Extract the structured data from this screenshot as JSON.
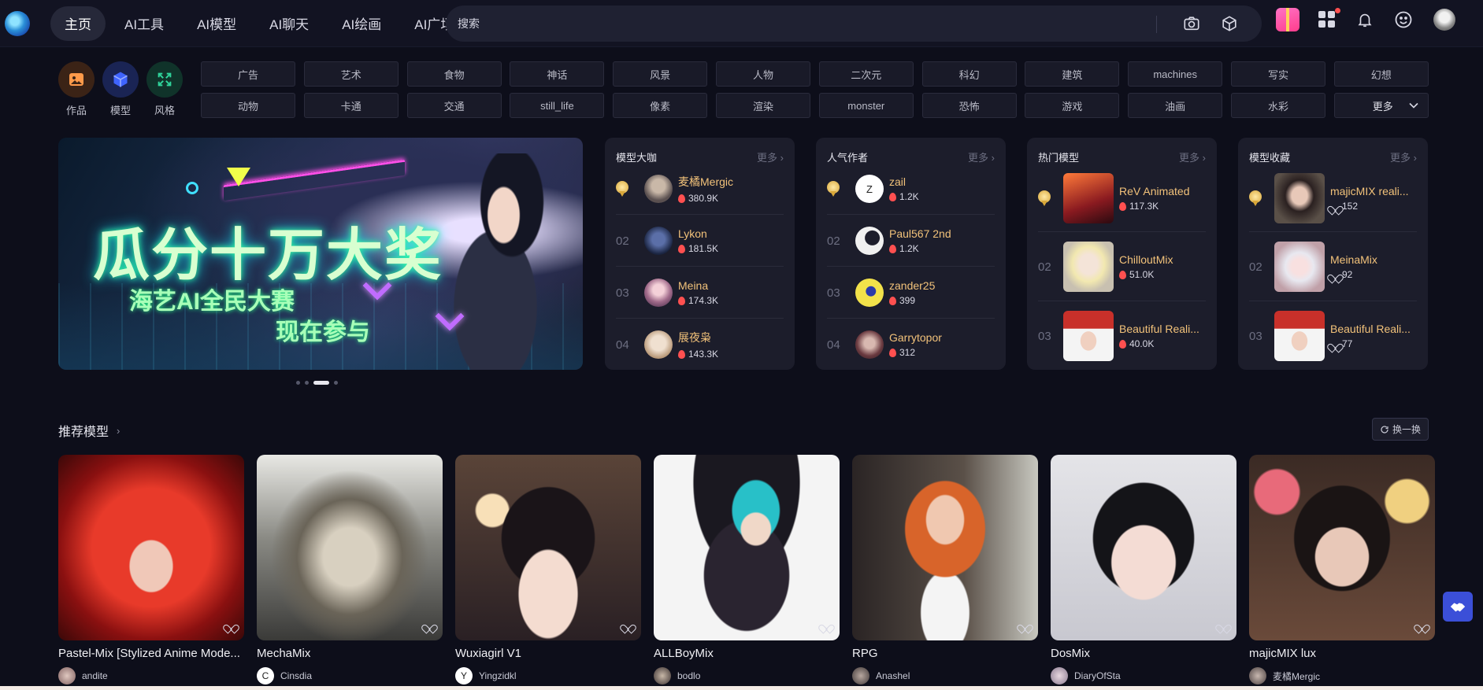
{
  "nav": {
    "items": [
      {
        "label": "主页",
        "active": true
      },
      {
        "label": "AI工具"
      },
      {
        "label": "AI模型"
      },
      {
        "label": "AI聊天"
      },
      {
        "label": "AI绘画"
      },
      {
        "label": "AI广场"
      }
    ]
  },
  "search": {
    "placeholder": "搜索"
  },
  "quick": [
    {
      "label": "作品",
      "icon": "image-icon"
    },
    {
      "label": "模型",
      "icon": "cube-icon"
    },
    {
      "label": "风格",
      "icon": "expand-icon"
    }
  ],
  "tags": [
    "广告",
    "艺术",
    "食物",
    "神话",
    "风景",
    "人物",
    "二次元",
    "科幻",
    "建筑",
    "machines",
    "写实",
    "幻想",
    "动物",
    "卡通",
    "交通",
    "still_life",
    "像素",
    "渲染",
    "monster",
    "恐怖",
    "游戏",
    "油画",
    "水彩"
  ],
  "tags_more": "更多",
  "banner": {
    "title": "瓜分十万大奖",
    "line1": "海艺AI全民大赛",
    "line2": "现在参与"
  },
  "panels": [
    {
      "title": "模型大咖",
      "more": "更多",
      "rows": [
        {
          "rank": "1",
          "name": "麦橘Mergic",
          "stat": "380.9K"
        },
        {
          "rank": "02",
          "name": "Lykon",
          "stat": "181.5K"
        },
        {
          "rank": "03",
          "name": "Meina",
          "stat": "174.3K"
        },
        {
          "rank": "04",
          "name": "展夜枭",
          "stat": "143.3K"
        }
      ]
    },
    {
      "title": "人气作者",
      "more": "更多",
      "rows": [
        {
          "rank": "1",
          "name": "zail",
          "stat": "1.2K",
          "initial": "Z"
        },
        {
          "rank": "02",
          "name": "Paul567 2nd",
          "stat": "1.2K"
        },
        {
          "rank": "03",
          "name": "zander25",
          "stat": "399"
        },
        {
          "rank": "04",
          "name": "Garrytopor",
          "stat": "312"
        }
      ]
    },
    {
      "title": "热门模型",
      "more": "更多",
      "rows": [
        {
          "rank": "1",
          "name": "ReV Animated",
          "stat": "117.3K"
        },
        {
          "rank": "02",
          "name": "ChilloutMix",
          "stat": "51.0K"
        },
        {
          "rank": "03",
          "name": "Beautiful Reali...",
          "stat": "40.0K"
        }
      ]
    },
    {
      "title": "模型收藏",
      "more": "更多",
      "rows": [
        {
          "rank": "1",
          "name": "majicMIX reali...",
          "stat": "152"
        },
        {
          "rank": "02",
          "name": "MeinaMix",
          "stat": "92"
        },
        {
          "rank": "03",
          "name": "Beautiful Reali...",
          "stat": "77"
        }
      ]
    }
  ],
  "recommend": {
    "title": "推荐模型",
    "swap_label": "换一换",
    "cards": [
      {
        "name": "Pastel-Mix [Stylized Anime Mode...",
        "author": "andite"
      },
      {
        "name": "MechaMix",
        "author": "Cinsdia",
        "initial": "C"
      },
      {
        "name": "Wuxiagirl V1",
        "author": "Yingzidkl",
        "initial": "Y"
      },
      {
        "name": "ALLBoyMix",
        "author": "bodlo"
      },
      {
        "name": "RPG",
        "author": "Anashel"
      },
      {
        "name": "DosMix",
        "author": "DiaryOfSta"
      },
      {
        "name": "majicMIX lux",
        "author": "麦橘Mergic"
      }
    ]
  }
}
